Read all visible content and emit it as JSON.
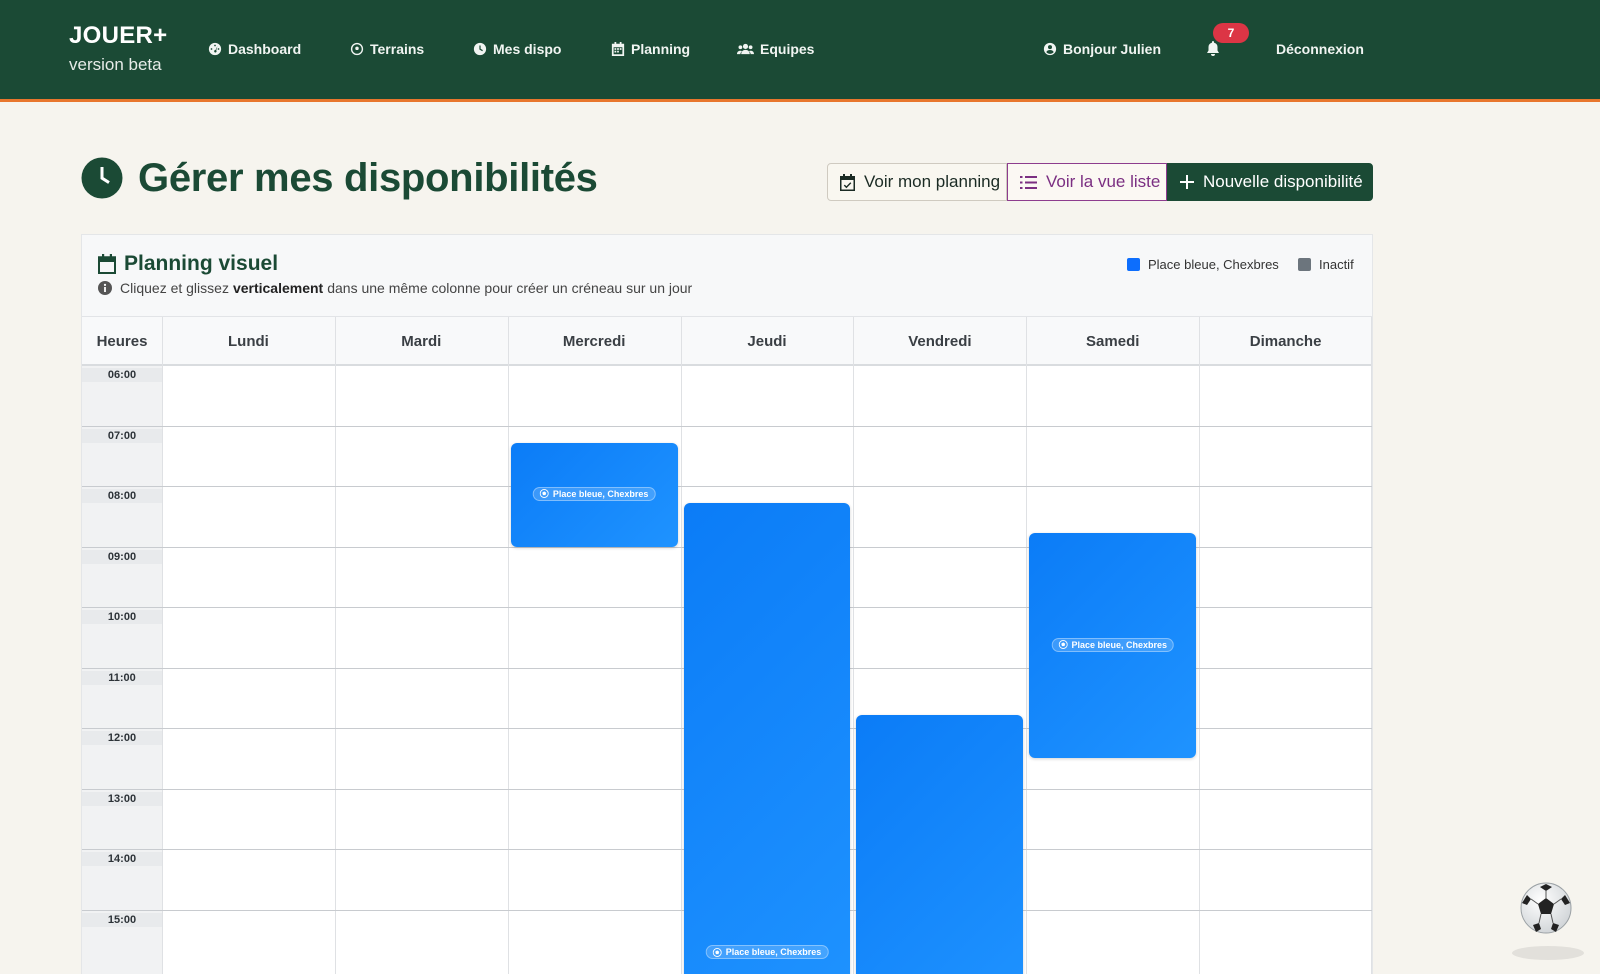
{
  "nav": {
    "brand_title": "JOUER+",
    "brand_sub": "version beta",
    "items": [
      {
        "label": "Dashboard",
        "icon": "tachometer-icon"
      },
      {
        "label": "Terrains",
        "icon": "soccer-ball-icon"
      },
      {
        "label": "Mes dispo",
        "icon": "clock-icon"
      },
      {
        "label": "Planning",
        "icon": "calendar-icon"
      },
      {
        "label": "Equipes",
        "icon": "users-icon"
      }
    ],
    "greeting": "Bonjour Julien",
    "notifications_count": "7",
    "logout": "Déconnexion"
  },
  "header": {
    "title": "Gérer mes disponibilités",
    "btn_planning": "Voir mon planning",
    "btn_liste": "Voir la vue liste",
    "btn_new": "Nouvelle disponibilité"
  },
  "card": {
    "title": "Planning visuel",
    "hint_before": "Cliquez et glissez",
    "hint_bold": "verticalement",
    "hint_after": "dans une même colonne pour créer un créneau sur un jour",
    "legend": [
      {
        "label": "Place bleue, Chexbres",
        "color": "#0d6efd"
      },
      {
        "label": "Inactif",
        "color": "#6c757d"
      }
    ]
  },
  "calendar": {
    "hours_header": "Heures",
    "days": [
      "Lundi",
      "Mardi",
      "Mercredi",
      "Jeudi",
      "Vendredi",
      "Samedi",
      "Dimanche"
    ],
    "hours": [
      "06:00",
      "07:00",
      "08:00",
      "09:00",
      "10:00",
      "11:00",
      "12:00",
      "13:00",
      "14:00",
      "15:00"
    ],
    "slots": [
      {
        "day": "Mercredi",
        "start": "07:15",
        "end": "09:00",
        "label": "Place bleue, Chexbres"
      },
      {
        "day": "Jeudi",
        "start": "08:15",
        "end": "",
        "label": "Place bleue, Chexbres"
      },
      {
        "day": "Vendredi",
        "start": "11:45",
        "end": "",
        "label": ""
      },
      {
        "day": "Samedi",
        "start": "08:45",
        "end": "12:30",
        "label": "Place bleue, Chexbres"
      }
    ]
  }
}
